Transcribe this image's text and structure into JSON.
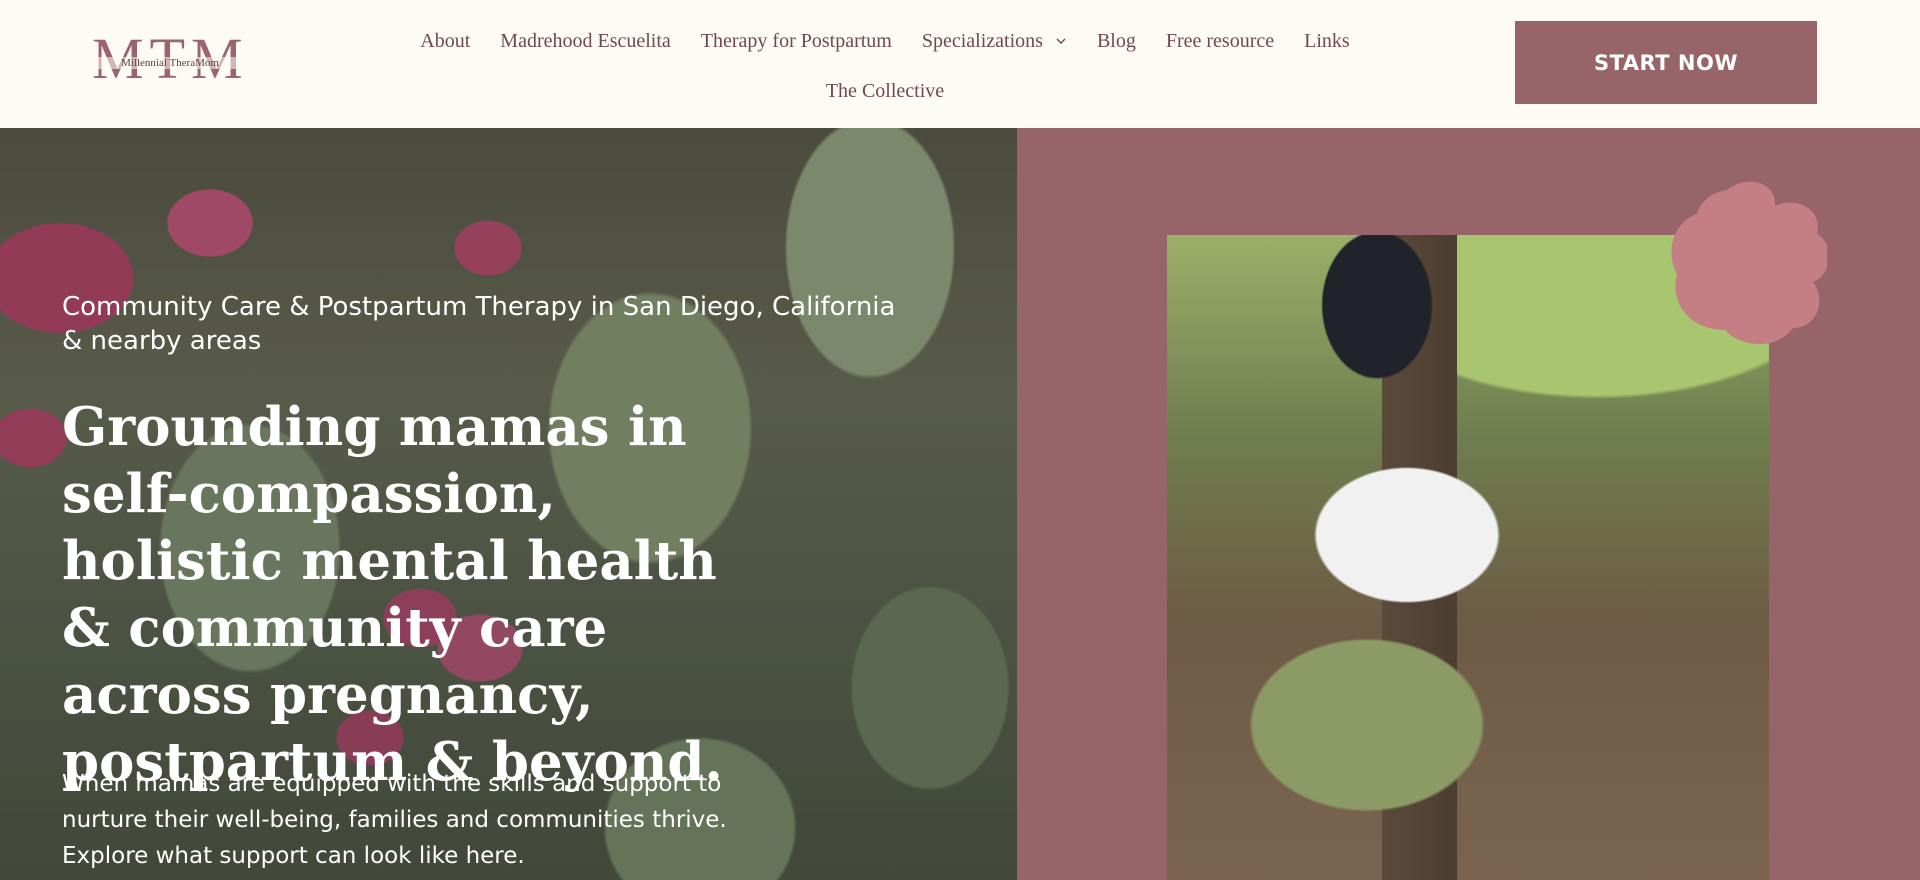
{
  "brand": {
    "logo_letters": "MTM",
    "logo_tagline": "Millennial TheraMom",
    "logo_color": "#9a656a",
    "accent_color": "#976469",
    "blob_color": "#c47f85",
    "background_color": "#fefbf4"
  },
  "nav": {
    "items": [
      {
        "label": "About"
      },
      {
        "label": "Madrehood Escuelita"
      },
      {
        "label": "Therapy for Postpartum"
      },
      {
        "label": "Specializations",
        "icon": "chevron-down-icon"
      },
      {
        "label": "Blog"
      },
      {
        "label": "Free resource"
      },
      {
        "label": "Links"
      },
      {
        "label": "The Collective"
      }
    ],
    "cta_label": "START NOW"
  },
  "hero": {
    "eyebrow": "Community Care & Postpartum Therapy in San Diego, California & nearby areas",
    "headline": "Grounding mamas in self-compassion, holistic mental health & community care across pregnancy, postpartum & beyond.",
    "subcopy": "When mamas are equipped with the skills and support to nurture their well-being, families and communities thrive. Explore what support can look like here."
  }
}
